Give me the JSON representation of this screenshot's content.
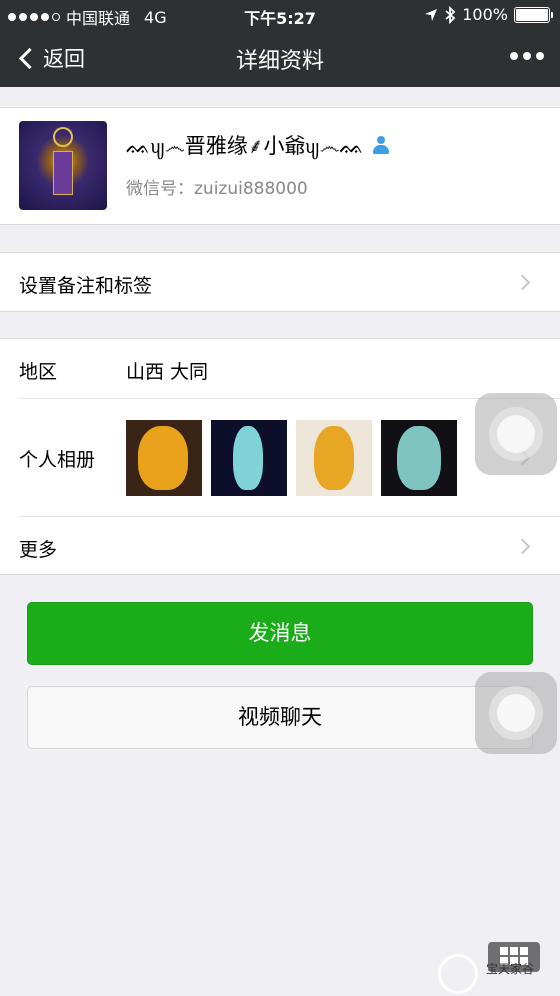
{
  "status_bar": {
    "carrier": "中国联通",
    "network": "4G",
    "time": "下午5:27",
    "battery": "100%"
  },
  "nav": {
    "back_label": "返回",
    "title": "详细资料",
    "more_icon": "ellipsis-icon"
  },
  "profile": {
    "nickname": "ᨐᦼ෴晋雅缘⸙小爺ᦼ෴ᨐ",
    "wechat_id": "微信号：zuizui888000",
    "gender_icon": "person-icon"
  },
  "remark": {
    "label": "设置备注和标签"
  },
  "info": {
    "region_label": "地区",
    "region_value": "山西 大同",
    "album_label": "个人相册",
    "more_label": "更多"
  },
  "actions": {
    "send_message": "发消息",
    "video_call": "视频聊天"
  },
  "colors": {
    "nav_bg": "#2e3132",
    "send_button": "#1aad19",
    "page_bg": "#efeff4"
  },
  "watermark": {
    "text": "宝天家谷"
  }
}
